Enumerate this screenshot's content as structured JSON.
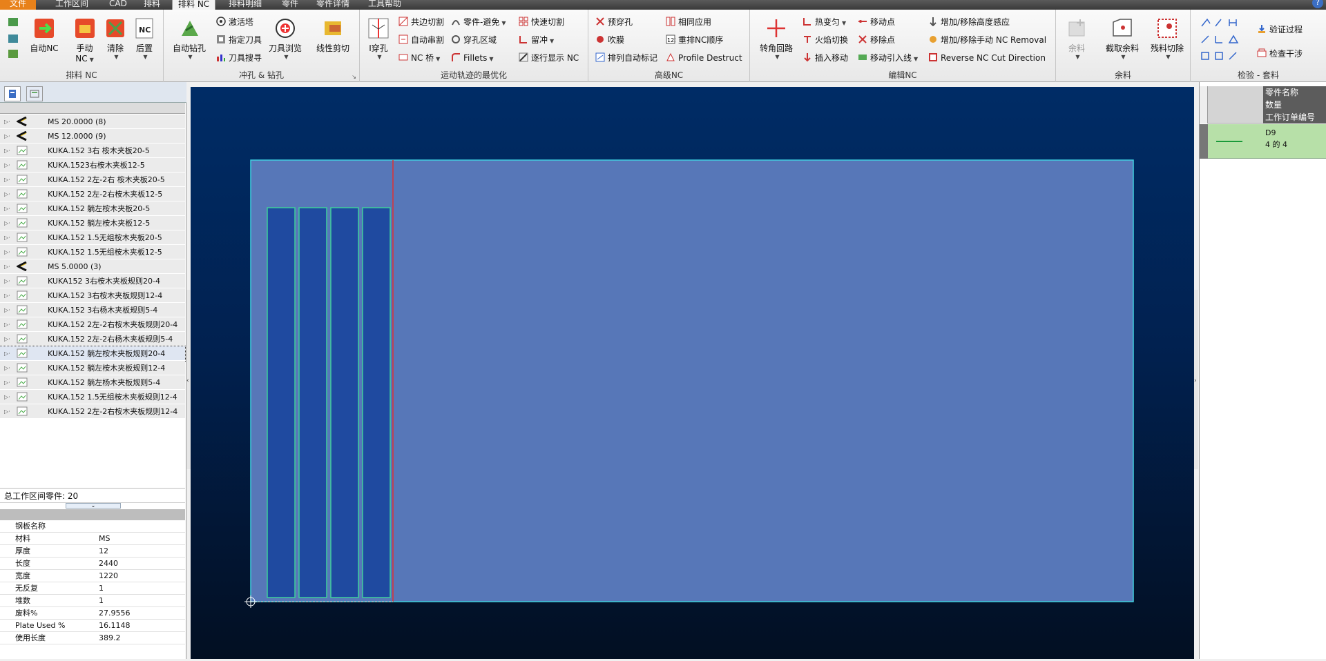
{
  "menu_tabs": [
    "文件",
    "工作区间",
    "CAD",
    "排料",
    "排料 NC",
    "排料明细",
    "零件",
    "零件详情",
    "工具帮助"
  ],
  "active_tab": "排料 NC",
  "help_icon": "?",
  "ribbon": {
    "groups": [
      "排料 NC",
      "冲孔 & 钻孔",
      "运动轨迹的最优化",
      "高级NC",
      "编辑NC",
      "余料",
      "检验 - 套料"
    ],
    "nest_nc": {
      "auto_nc": "自动NC",
      "manual_nc": "手动\nNC",
      "clear": "清除",
      "post": "后置"
    },
    "punch": {
      "auto_drill": "自动钻孔",
      "activate_turret": "激活塔",
      "assign_tool": "指定刀具",
      "tool_search": "刀具搜寻",
      "tool_browse": "刀具浏览",
      "linear_cut": "线性剪切"
    },
    "motion": {
      "pierce": "I穿孔",
      "common_cut": "共边切割",
      "auto_chain": "自动串割",
      "nc_bridge": "NC 桥",
      "part_avoid": "零件-避免",
      "pierce_area": "穿孔区域",
      "fillets": "Fillets",
      "quick_cut": "快速切割",
      "leave": "留冲",
      "line_display": "逐行显示 NC"
    },
    "advanced": {
      "pre_pierce": "预穿孔",
      "blow": "吹膜",
      "auto_mark": "排列自动标记",
      "same_apply": "相同应用",
      "reorder_nc": "重排NC顺序",
      "profile_destruct": "Profile Destruct"
    },
    "edit": {
      "corner_loop": "转角回路",
      "hot_deform": "热变匀",
      "flame_switch": "火焰切换",
      "insert_move": "插入移动",
      "move_point": "移动点",
      "remove_point": "移除点",
      "move_lead": "移动引入线",
      "add_remove_height": "增加/移除高度感应",
      "add_remove_manual": "增加/移除手动 NC Removal",
      "reverse_nc": "Reverse NC Cut Direction"
    },
    "remnant": {
      "remnant": "余料",
      "cut_remnant": "截取余料",
      "remnant_cut": "残料切除"
    },
    "verify": {
      "verify_process": "验证过程",
      "check_interference": "检查干涉"
    }
  },
  "tree": {
    "rows": [
      {
        "type": "plate",
        "label": "MS 20.0000 (8)"
      },
      {
        "type": "plate",
        "label": "MS 12.0000 (9)"
      },
      {
        "type": "part",
        "label": "KUKA.152 3右 桉木夹板20-5"
      },
      {
        "type": "part",
        "label": "KUKA.1523右桉木夹板12-5"
      },
      {
        "type": "part",
        "label": "KUKA.152 2左-2右 桉木夹板20-5"
      },
      {
        "type": "part",
        "label": "KUKA.152  2左-2右桉木夹板12-5"
      },
      {
        "type": "part",
        "label": "KUKA.152  躺左桉木夹板20-5"
      },
      {
        "type": "part",
        "label": "KUKA.152  躺左桉木夹板12-5"
      },
      {
        "type": "part",
        "label": "KUKA.152  1.5无组桉木夹板20-5"
      },
      {
        "type": "part",
        "label": "KUKA.152  1.5无组桉木夹板12-5"
      },
      {
        "type": "plate",
        "label": "MS 5.0000 (3)"
      },
      {
        "type": "part",
        "label": "KUKA152 3右桉木夹板规则20-4"
      },
      {
        "type": "part",
        "label": "KUKA.152  3右桉木夹板规则12-4"
      },
      {
        "type": "part",
        "label": "KUKA.152  3右杨木夹板规则5-4"
      },
      {
        "type": "part",
        "label": "KUKA.152  2左-2右桉木夹板规则20-4"
      },
      {
        "type": "part",
        "label": "KUKA.152  2左-2右杨木夹板规则5-4"
      },
      {
        "type": "part",
        "label": "KUKA.152  躺左桉木夹板规则20-4",
        "selected": true
      },
      {
        "type": "part",
        "label": "KUKA.152  躺左桉木夹板规则12-4"
      },
      {
        "type": "part",
        "label": "KUKA.152  躺左杨木夹板规则5-4"
      },
      {
        "type": "part",
        "label": "KUKA.152  1.5无组桉木夹板规则12-4"
      },
      {
        "type": "part",
        "label": "KUKA.152  2左-2右桉木夹板规则12-4"
      }
    ]
  },
  "part_count": "总工作区间零件: 20",
  "properties": [
    {
      "key": "钢板名称",
      "value": ""
    },
    {
      "key": "材料",
      "value": "MS"
    },
    {
      "key": "厚度",
      "value": "12"
    },
    {
      "key": "长度",
      "value": "2440"
    },
    {
      "key": "宽度",
      "value": "1220"
    },
    {
      "key": "无反复",
      "value": "1"
    },
    {
      "key": "堆数",
      "value": "1"
    },
    {
      "key": "废料%",
      "value": "27.9556"
    },
    {
      "key": "Plate Used %",
      "value": "16.1148"
    },
    {
      "key": "使用长度",
      "value": "389.2"
    }
  ],
  "right_panel": {
    "headers": [
      "零件名称",
      "数量",
      "工作订单编号"
    ],
    "item": {
      "name": "D9",
      "qty": "4 的 4"
    }
  },
  "colors": {
    "plate": "#5777b8",
    "part": "#1f4aa0",
    "part_border": "#3ecf9a",
    "cut_line": "#e03030",
    "selected_row": "#b7e0a8"
  }
}
